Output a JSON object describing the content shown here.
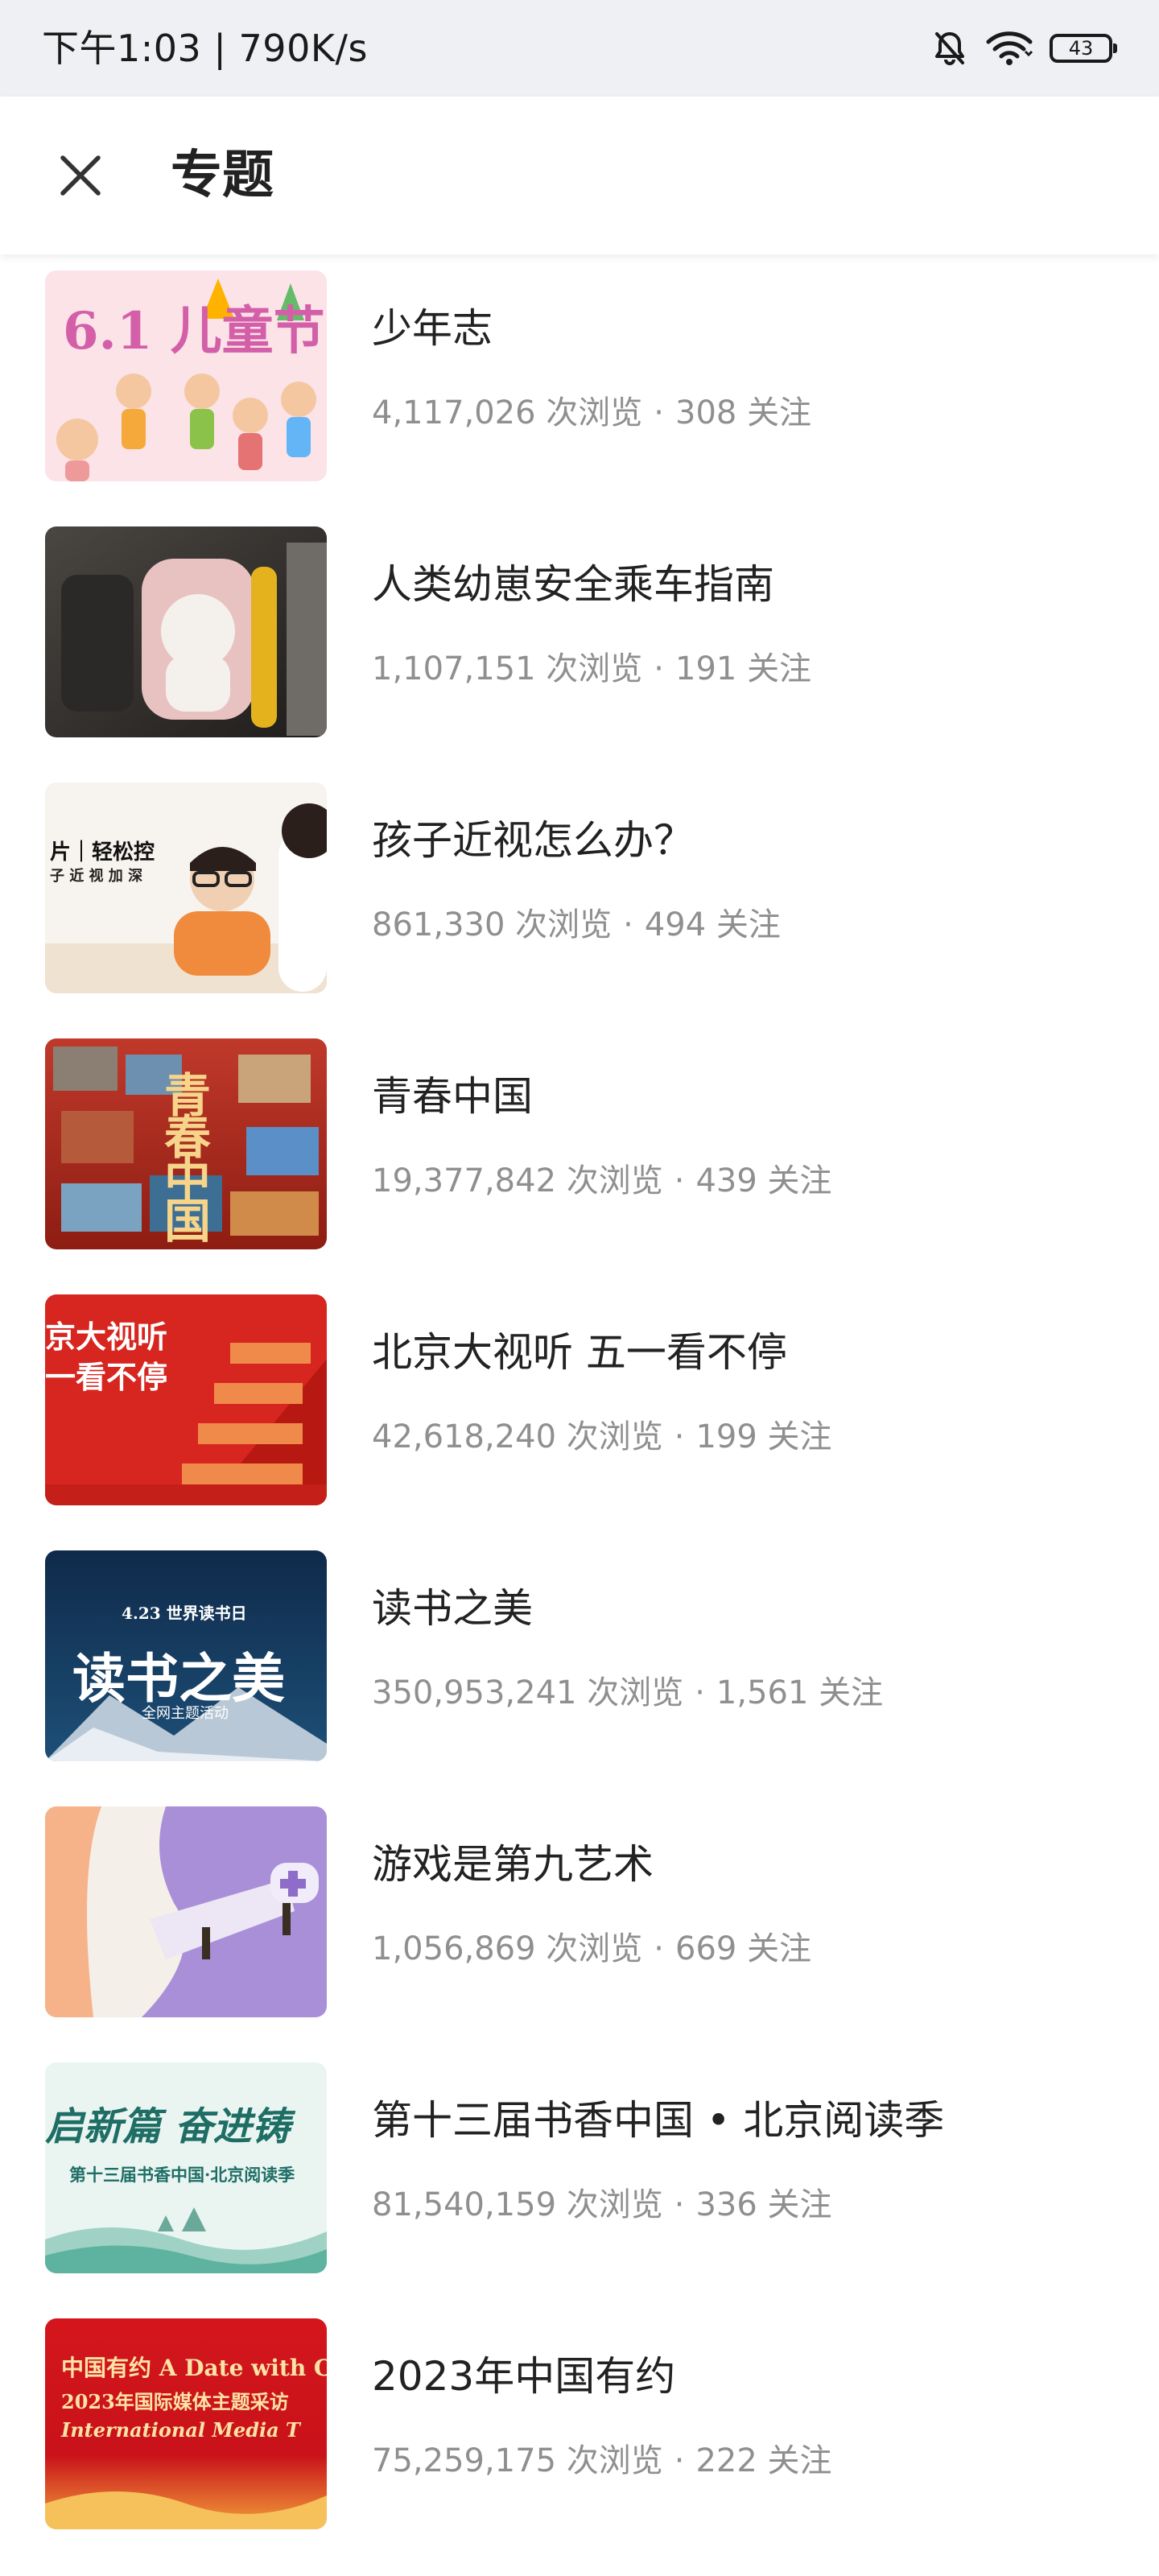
{
  "status_bar": {
    "time": "下午1:03 | 790K/s",
    "battery": "43",
    "icons": [
      "mute-bell-icon",
      "wifi-icon",
      "battery-icon"
    ]
  },
  "header": {
    "title": "专题",
    "close_icon": "close-icon"
  },
  "labels": {
    "views_suffix": "次浏览",
    "follows_suffix": "关注",
    "separator": "·"
  },
  "colors": {
    "title_text": "#222222",
    "meta_text": "#8f8f8f",
    "status_bar_bg": "#eef0f3"
  },
  "topics": [
    {
      "title": "少年志",
      "views": "4,117,026",
      "follows": "308",
      "thumb_text": "6.1 儿童节"
    },
    {
      "title": "人类幼崽安全乘车指南",
      "views": "1,107,151",
      "follows": "191",
      "thumb_text": ""
    },
    {
      "title": "孩子近视怎么办？",
      "views": "861,330",
      "follows": "494",
      "thumb_text": "片｜轻松控",
      "thumb_text_2": "子 近 视 加 深"
    },
    {
      "title": "青春中国",
      "views": "19,377,842",
      "follows": "439",
      "thumb_text": "青春中国"
    },
    {
      "title": "北京大视听 五一看不停",
      "views": "42,618,240",
      "follows": "199",
      "thumb_text": "京大视听",
      "thumb_text_2": "一看不停"
    },
    {
      "title": "读书之美",
      "views": "350,953,241",
      "follows": "1,561",
      "thumb_text": "读书之美",
      "thumb_text_2": "4.23 世界读书日",
      "thumb_text_3": "全网主题活动"
    },
    {
      "title": "游戏是第九艺术",
      "views": "1,056,869",
      "follows": "669",
      "thumb_text": ""
    },
    {
      "title": "第十三届书香中国 • 北京阅读季",
      "views": "81,540,159",
      "follows": "336",
      "thumb_text": "启新篇 奋进铸",
      "thumb_text_2": "第十三届书香中国·北京阅读季"
    },
    {
      "title": "2023年中国有约",
      "views": "75,259,175",
      "follows": "222",
      "thumb_text": "中国有约 A Date with C",
      "thumb_text_2": "2023年国际媒体主题采访",
      "thumb_text_3": "International Media T"
    }
  ]
}
